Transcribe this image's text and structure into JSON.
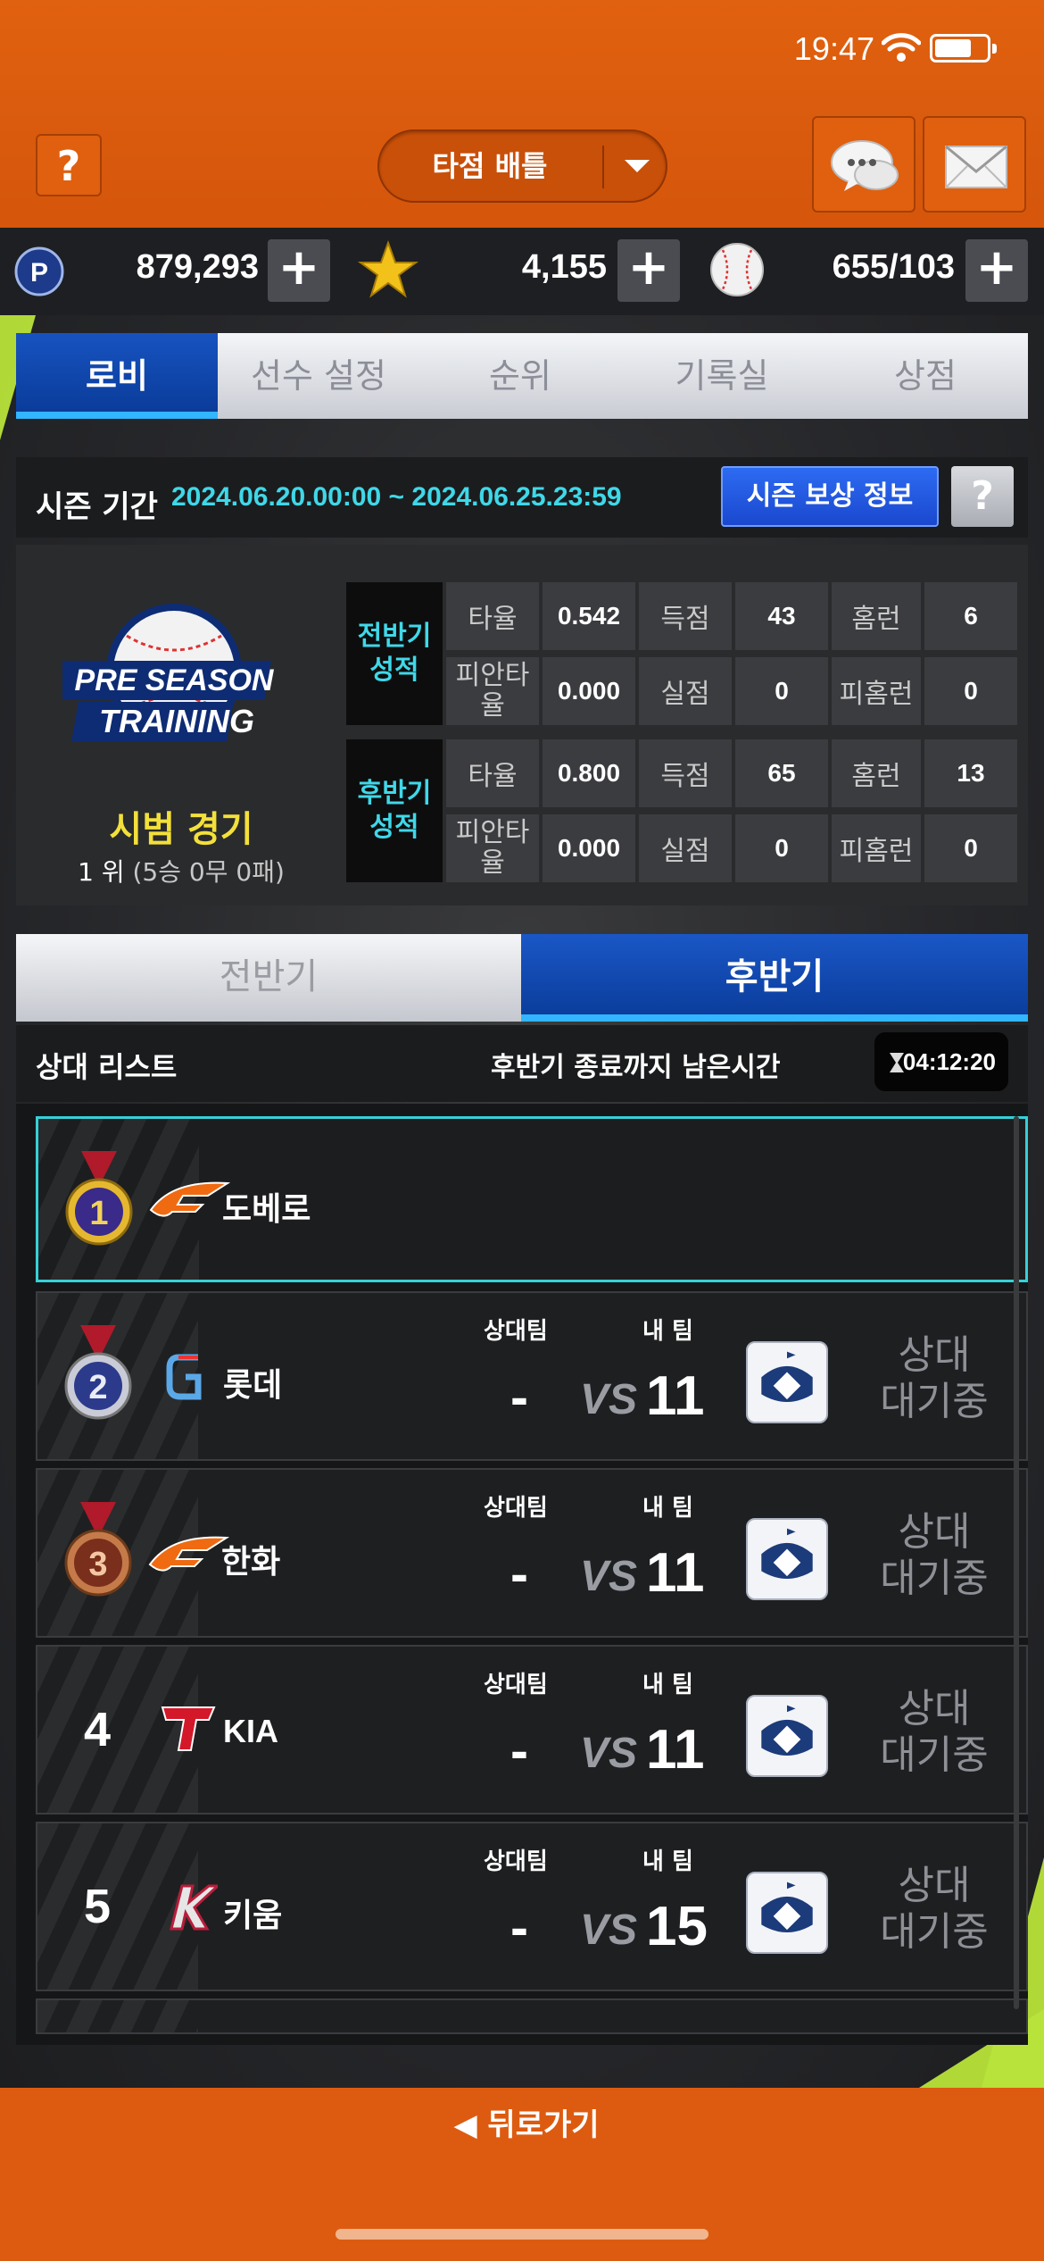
{
  "status_bar": {
    "time": "19:47"
  },
  "header": {
    "help_label": "?",
    "mode_label": "타점 배틀"
  },
  "currencies": [
    {
      "icon": "p-coin-icon",
      "value": "879,293"
    },
    {
      "icon": "star-icon",
      "value": "4,155"
    },
    {
      "icon": "baseball-icon",
      "value": "655/103"
    }
  ],
  "plus_label": "+",
  "tabs": [
    "로비",
    "선수 설정",
    "순위",
    "기록실",
    "상점"
  ],
  "season": {
    "label": "시즌 기간",
    "dates": "2024.06.20.00:00 ~ 2024.06.25.23:59",
    "reward_button": "시즌 보상 정보",
    "help": "?"
  },
  "mode": {
    "logo_line1": "PRE SEASON",
    "logo_line2": "TRAINING",
    "title": "시범 경기",
    "rank": "1 위",
    "record": "(5승 0무 0패)"
  },
  "stats": {
    "first_half": {
      "label_line1": "전반기",
      "label_line2": "성적",
      "row1": [
        "타율",
        "0.542",
        "득점",
        "43",
        "홈런",
        "6"
      ],
      "row2": [
        "피안타\n율",
        "0.000",
        "실점",
        "0",
        "피홈런",
        "0"
      ]
    },
    "second_half": {
      "label_line1": "후반기",
      "label_line2": "성적",
      "row1": [
        "타율",
        "0.800",
        "득점",
        "65",
        "홈런",
        "13"
      ],
      "row2": [
        "피안타\n율",
        "0.000",
        "실점",
        "0",
        "피홈런",
        "0"
      ]
    }
  },
  "half_tabs": {
    "first": "전반기",
    "second": "후반기"
  },
  "opponents": {
    "list_label": "상대 리스트",
    "remaining_label": "후반기 종료까지 남은시간",
    "timer": "04:12:20",
    "opp_header": "상대팀",
    "my_header": "내 팀",
    "vs": "VS",
    "waiting_line1": "상대",
    "waiting_line2": "대기중",
    "rows": [
      {
        "rank": "1",
        "team": "도베로",
        "opp": "",
        "my": ""
      },
      {
        "rank": "2",
        "team": "롯데",
        "opp": "-",
        "my": "11"
      },
      {
        "rank": "3",
        "team": "한화",
        "opp": "-",
        "my": "11"
      },
      {
        "rank": "4",
        "team": "KIA",
        "opp": "-",
        "my": "11"
      },
      {
        "rank": "5",
        "team": "키움",
        "opp": "-",
        "my": "15"
      }
    ]
  },
  "footer": {
    "back_label": "◀ 뒤로가기"
  },
  "colors": {
    "orange": "#e0610f",
    "accent_blue": "#1753c0",
    "cyan": "#3fd8e8",
    "gold": "#f3e03a"
  }
}
